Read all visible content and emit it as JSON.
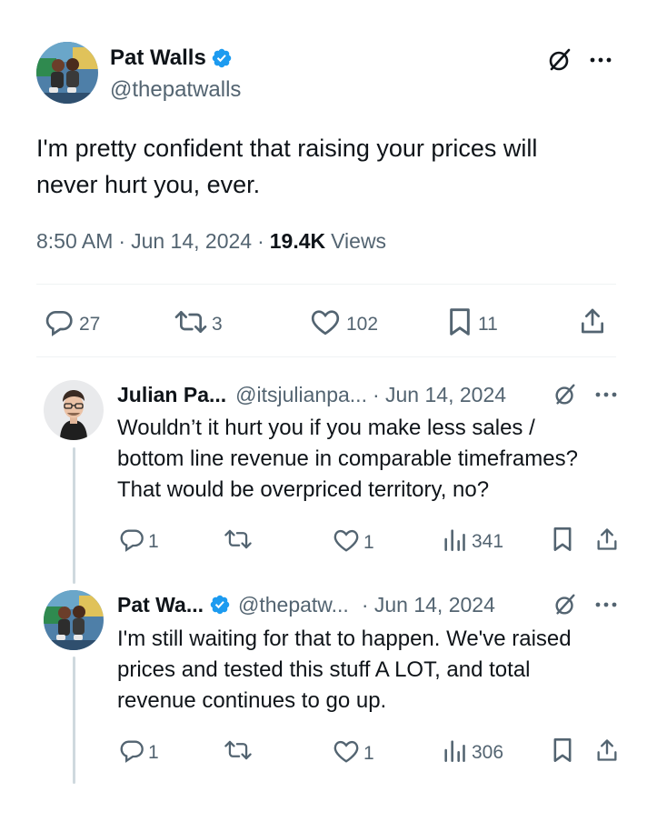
{
  "main_tweet": {
    "author_name": "Pat Walls",
    "author_handle": "@thepatwalls",
    "text_line1": "I'm pretty confident that raising your prices will",
    "text_line2": "never hurt you, ever.",
    "time": "8:50 AM",
    "date": "Jun 14, 2024",
    "views_count": "19.4K",
    "views_label": "Views",
    "replies": "27",
    "reposts": "3",
    "likes": "102",
    "bookmarks": "11"
  },
  "replies": [
    {
      "author_name": "Julian Pa...",
      "author_handle": "@itsjulianpa...",
      "date": "· Jun 14, 2024",
      "text_lines": [
        "Wouldn’t it hurt you if you make less sales /",
        "bottom line revenue in comparable timeframes?",
        "That would be overpriced territory, no?"
      ],
      "replies": "1",
      "likes": "1",
      "views": "341"
    },
    {
      "author_name": "Pat Wa...",
      "author_handle": "@thepatw...",
      "date": "· Jun 14, 2024",
      "text_lines": [
        "I'm still waiting for that to happen. We've raised",
        "prices and tested this stuff A LOT, and total",
        "revenue continues to go up."
      ],
      "replies": "1",
      "likes": "1",
      "views": "306"
    }
  ],
  "icons": {
    "grok": "grok-icon",
    "more": "more-icon",
    "reply": "reply-icon",
    "repost": "repost-icon",
    "like": "like-icon",
    "bookmark": "bookmark-icon",
    "share": "share-icon",
    "views": "views-icon",
    "verified": "verified-badge-icon"
  },
  "colors": {
    "text": "#0f1419",
    "muted": "#536471",
    "verified": "#1d9bf0",
    "divider": "#eff3f4"
  }
}
